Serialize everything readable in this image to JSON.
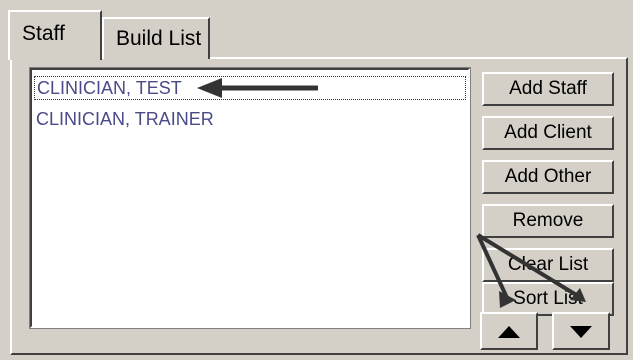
{
  "tabs": [
    {
      "label": "Staff"
    },
    {
      "label": "Build List"
    }
  ],
  "list": {
    "items": [
      {
        "label": "CLINICIAN, TEST",
        "selected": true
      },
      {
        "label": "CLINICIAN, TRAINER",
        "selected": false
      }
    ]
  },
  "buttons": {
    "add_staff": "Add Staff",
    "add_client": "Add Client",
    "add_other": "Add Other",
    "remove": "Remove",
    "clear_list": "Clear List",
    "sort_list": "Sort List"
  },
  "arrow_buttons": {
    "up_icon": "triangle-up-icon",
    "down_icon": "triangle-down-icon"
  },
  "annotations": {
    "arrow_color": "#333333"
  },
  "colors": {
    "face": "#d4d0c8",
    "list_text": "#4a4a8a"
  }
}
